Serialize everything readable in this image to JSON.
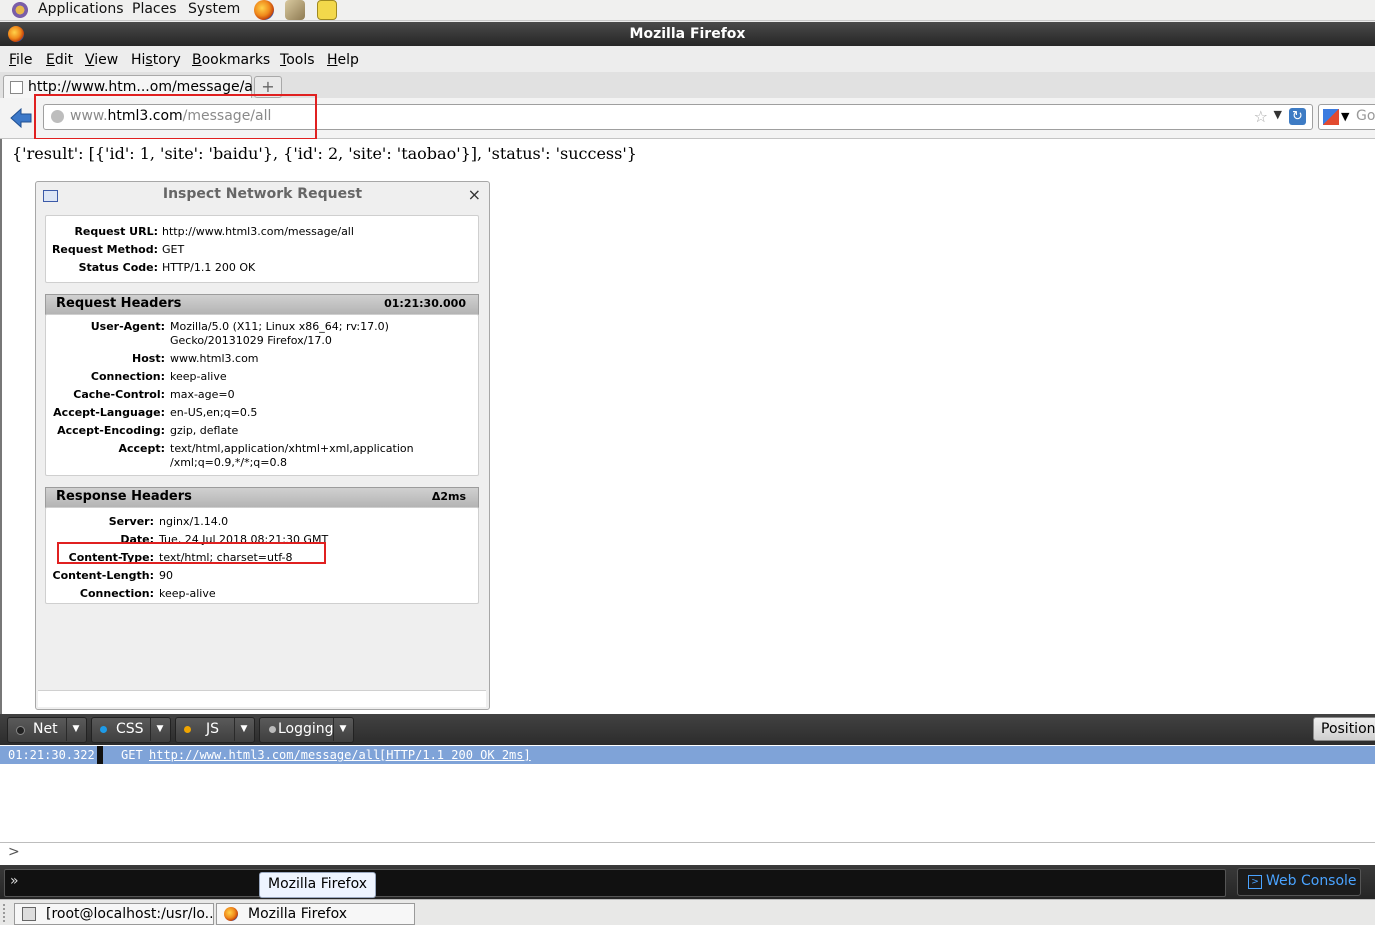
{
  "panel": {
    "menus": [
      "Applications",
      "Places",
      "System"
    ]
  },
  "window": {
    "title": "Mozilla Firefox"
  },
  "menubar": {
    "items": [
      {
        "pre": "",
        "key": "F",
        "post": "ile"
      },
      {
        "pre": "",
        "key": "E",
        "post": "dit"
      },
      {
        "pre": "",
        "key": "V",
        "post": "iew"
      },
      {
        "pre": "Hi",
        "key": "s",
        "post": "tory"
      },
      {
        "pre": "",
        "key": "B",
        "post": "ookmarks"
      },
      {
        "pre": "",
        "key": "T",
        "post": "ools"
      },
      {
        "pre": "",
        "key": "H",
        "post": "elp"
      }
    ]
  },
  "tabs": [
    {
      "label": "http://www.htm...om/message/all"
    }
  ],
  "urlbar": {
    "prefix": "www.",
    "domain": "html3.com",
    "path": "/message/all"
  },
  "search": {
    "placeholder": "Go"
  },
  "page": {
    "json_text": "{'result': [{'id': 1, 'site': 'baidu'}, {'id': 2, 'site': 'taobao'}], 'status': 'success'}"
  },
  "inspect": {
    "title": "Inspect Network Request",
    "summary": [
      {
        "key": "Request URL:",
        "value": "http://www.html3.com/message/all"
      },
      {
        "key": "Request Method:",
        "value": "GET"
      },
      {
        "key": "Status Code:",
        "value": "HTTP/1.1 200 OK"
      }
    ],
    "request_headers": {
      "title": "Request Headers",
      "time": "01:21:30.000",
      "rows": [
        {
          "key": "User-Agent:",
          "value": "Mozilla/5.0 (X11; Linux x86_64; rv:17.0)\nGecko/20131029 Firefox/17.0"
        },
        {
          "key": "Host:",
          "value": "www.html3.com"
        },
        {
          "key": "Connection:",
          "value": "keep-alive"
        },
        {
          "key": "Cache-Control:",
          "value": "max-age=0"
        },
        {
          "key": "Accept-Language:",
          "value": "en-US,en;q=0.5"
        },
        {
          "key": "Accept-Encoding:",
          "value": "gzip, deflate"
        },
        {
          "key": "Accept:",
          "value": "text/html,application/xhtml+xml,application\n/xml;q=0.9,*/*;q=0.8"
        }
      ]
    },
    "response_headers": {
      "title": "Response Headers",
      "time": "Δ2ms",
      "rows": [
        {
          "key": "Server:",
          "value": "nginx/1.14.0"
        },
        {
          "key": "Date:",
          "value": "Tue, 24 Jul 2018 08:21:30 GMT"
        },
        {
          "key": "Content-Type:",
          "value": "text/html; charset=utf-8"
        },
        {
          "key": "Content-Length:",
          "value": "90"
        },
        {
          "key": "Connection:",
          "value": "keep-alive"
        }
      ]
    }
  },
  "console": {
    "filters": [
      {
        "label": "Net",
        "color": "#222222"
      },
      {
        "label": "CSS",
        "color": "#1e9be8"
      },
      {
        "label": "JS",
        "color": "#f0a500"
      },
      {
        "label": "Logging",
        "color": "#bbbbbb"
      }
    ],
    "position_label": "Position",
    "log": {
      "timestamp": "01:21:30.322",
      "method": "GET",
      "url": "http://www.html3.com/message/all",
      "status": "[HTTP/1.1 200 OK 2ms]"
    },
    "prompt": ">"
  },
  "devtoolbar": {
    "command_prompt": "»",
    "tooltip": "Mozilla Firefox",
    "web_console_label": "Web Console"
  },
  "taskbar": {
    "items": [
      {
        "label": "[root@localhost:/usr/lo...",
        "icon": "terminal-icon"
      },
      {
        "label": "Mozilla Firefox",
        "icon": "firefox-icon"
      }
    ]
  }
}
